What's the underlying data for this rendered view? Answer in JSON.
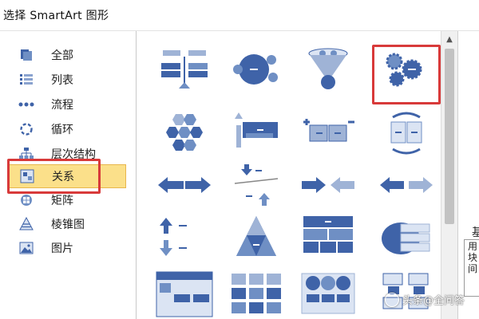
{
  "window": {
    "title": "选择 SmartArt 图形"
  },
  "sidebar": {
    "items": [
      {
        "label": "全部",
        "icon": "all-icon"
      },
      {
        "label": "列表",
        "icon": "list-icon"
      },
      {
        "label": "流程",
        "icon": "process-icon"
      },
      {
        "label": "循环",
        "icon": "cycle-icon"
      },
      {
        "label": "层次结构",
        "icon": "hierarchy-icon"
      },
      {
        "label": "关系",
        "icon": "relationship-icon",
        "selected": true
      },
      {
        "label": "矩阵",
        "icon": "matrix-icon"
      },
      {
        "label": "棱锥图",
        "icon": "pyramid-icon"
      },
      {
        "label": "图片",
        "icon": "picture-icon"
      }
    ]
  },
  "gallery": {
    "selected_index": 3,
    "items": [
      "balance-graphic",
      "circle-relationship-graphic",
      "funnel-graphic",
      "gear-graphic",
      "hexagon-cluster-graphic",
      "arrow-ribbon-graphic",
      "plus-minus-graphic",
      "opposing-ideas-graphic",
      "diverging-arrows-graphic",
      "counterbalance-arrows-graphic",
      "converging-arrows-graphic",
      "opposing-arrows-graphic",
      "up-down-arrows-graphic",
      "segmented-pyramid-graphic",
      "table-hierarchy-graphic",
      "stacked-venn-graphic",
      "title-picture-graphic",
      "grid-matrix-graphic",
      "circle-process-graphic",
      "tab-list-graphic"
    ]
  },
  "right_panel": {
    "heading": "基",
    "text": "用块间"
  },
  "watermark": {
    "text": "头条@全问答"
  },
  "colors": {
    "selection_fill": "#fbe08a",
    "highlight_red": "#d83a3a",
    "graphic_blue": "#3f63a8"
  }
}
